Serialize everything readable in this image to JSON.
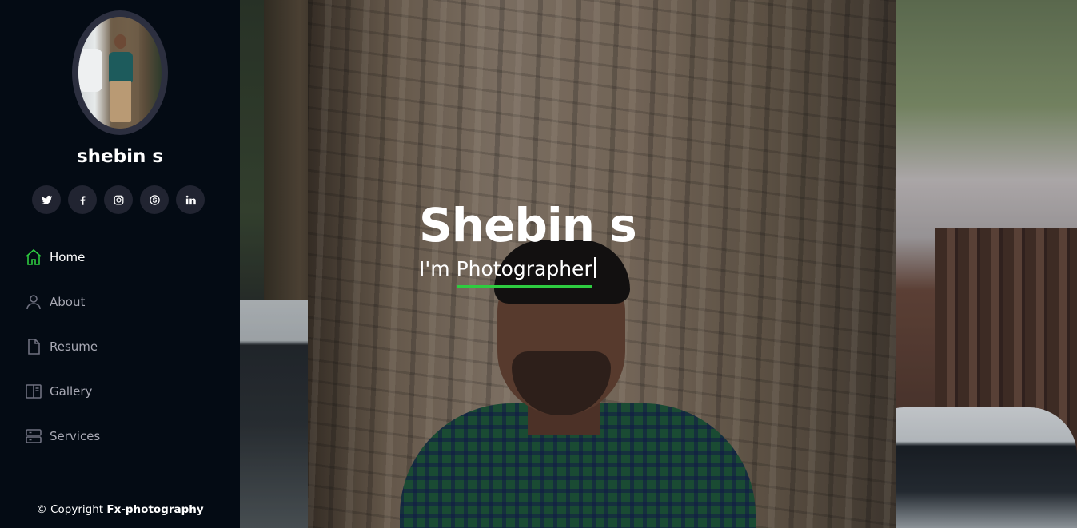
{
  "profile": {
    "name": "shebin s"
  },
  "socials": [
    {
      "icon": "twitter-icon",
      "label": "Twitter"
    },
    {
      "icon": "facebook-icon",
      "label": "Facebook"
    },
    {
      "icon": "instagram-icon",
      "label": "Instagram"
    },
    {
      "icon": "skype-icon",
      "label": "Skype"
    },
    {
      "icon": "linkedin-icon",
      "label": "LinkedIn"
    }
  ],
  "nav": {
    "items": [
      {
        "label": "Home",
        "icon": "home-icon",
        "active": true
      },
      {
        "label": "About",
        "icon": "person-icon",
        "active": false
      },
      {
        "label": "Resume",
        "icon": "file-icon",
        "active": false
      },
      {
        "label": "Gallery",
        "icon": "gallery-icon",
        "active": false
      },
      {
        "label": "Services",
        "icon": "server-icon",
        "active": false
      }
    ]
  },
  "footer": {
    "prefix": "© Copyright",
    "brand": "Fx-photography"
  },
  "hero": {
    "title": "Shebin s",
    "subtitle_prefix": "I'm",
    "subtitle_typed": "Photographer"
  },
  "colors": {
    "sidebar_bg": "#040b14",
    "accent": "#2ecc40",
    "social_bg": "#212431",
    "nav_text": "#a8a9b4"
  }
}
